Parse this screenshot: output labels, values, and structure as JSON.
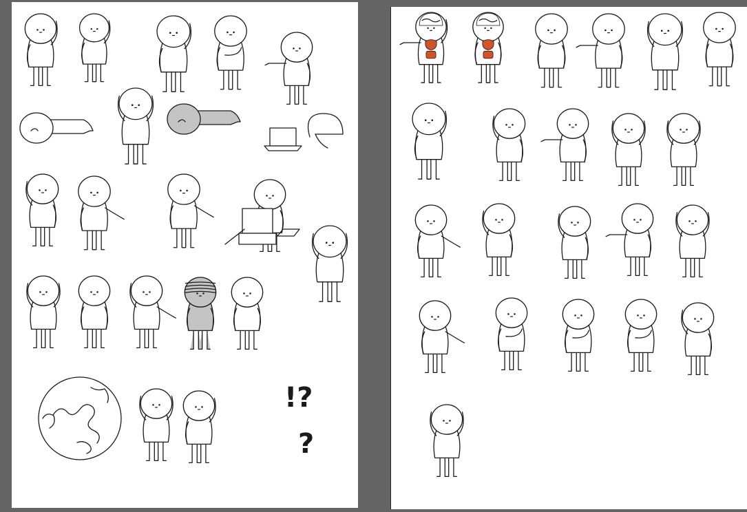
{
  "colors": {
    "background": "#646464",
    "sheet": "#ffffff",
    "ink": "#1a1a1a",
    "gray_fill": "#c4c4c4",
    "organ": "#d2522a"
  },
  "left_sheet": {
    "glyphs": {
      "exclaim_question": "!?",
      "question": "?"
    }
  }
}
